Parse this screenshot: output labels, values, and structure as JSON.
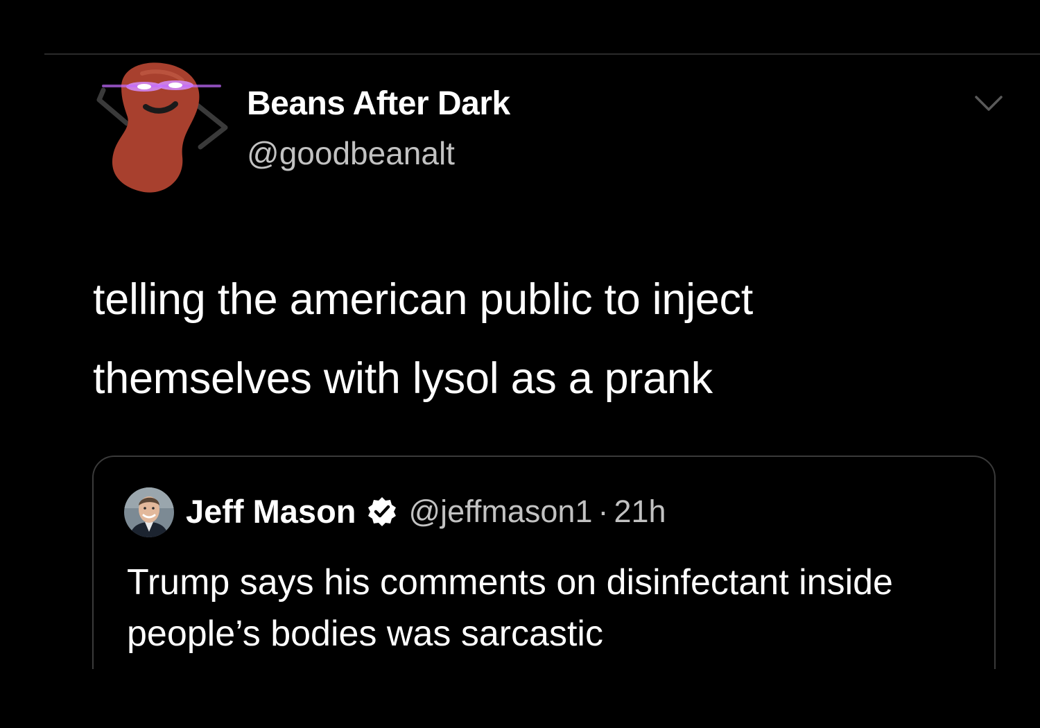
{
  "tweet": {
    "display_name": "Beans After Dark",
    "handle": "@goodbeanalt",
    "text": "telling the american public to inject themselves with lysol as a prank",
    "avatar_icon": "red-bean-glowing-eyes-avatar",
    "menu_icon": "chevron-down-icon"
  },
  "quoted_tweet": {
    "display_name": "Jeff Mason",
    "verified_icon": "verified-badge-icon",
    "handle": "@jeffmason1",
    "separator": "·",
    "time": "21h",
    "text": "Trump says his comments on disinfectant inside people’s bodies was sarcastic"
  },
  "colors": {
    "background": "#000000",
    "primary_text": "#ffffff",
    "secondary_text": "#c2c2c2",
    "border": "#3a3a3a",
    "bean": "#a8402e",
    "eye_glow": "#c36bff"
  }
}
